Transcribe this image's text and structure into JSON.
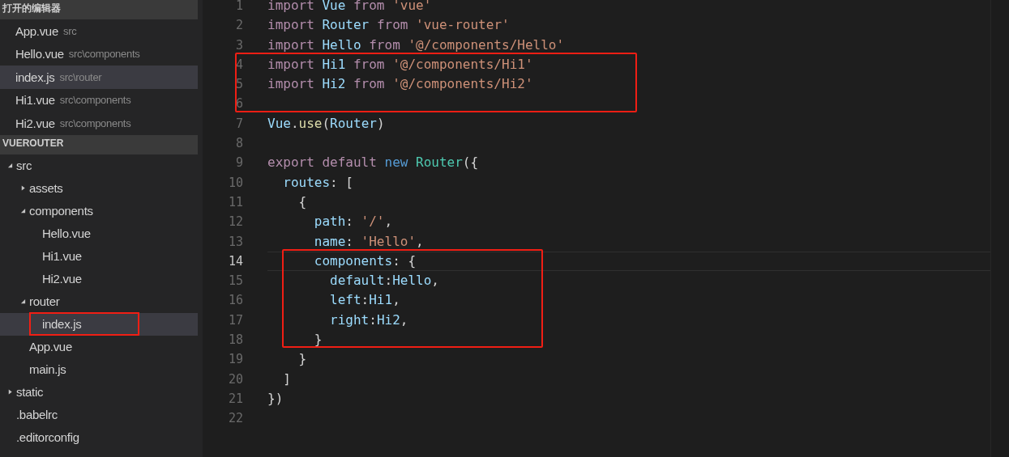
{
  "sidebar": {
    "open_editors": {
      "title": "打开的编辑器",
      "items": [
        {
          "name": "App.vue",
          "path": "src",
          "selected": false
        },
        {
          "name": "Hello.vue",
          "path": "src\\components",
          "selected": false
        },
        {
          "name": "index.js",
          "path": "src\\router",
          "selected": true
        },
        {
          "name": "Hi1.vue",
          "path": "src\\components",
          "selected": false
        },
        {
          "name": "Hi2.vue",
          "path": "src\\components",
          "selected": false
        }
      ]
    },
    "explorer": {
      "title": "VUEROUTER",
      "tree": [
        {
          "kind": "folder",
          "name": "src",
          "expanded": true,
          "selected": false,
          "boxed": false,
          "children": [
            {
              "kind": "folder",
              "name": "assets",
              "expanded": false,
              "selected": false,
              "boxed": false
            },
            {
              "kind": "folder",
              "name": "components",
              "expanded": true,
              "selected": false,
              "boxed": false,
              "children": [
                {
                  "kind": "file",
                  "name": "Hello.vue",
                  "selected": false,
                  "boxed": false
                },
                {
                  "kind": "file",
                  "name": "Hi1.vue",
                  "selected": false,
                  "boxed": false
                },
                {
                  "kind": "file",
                  "name": "Hi2.vue",
                  "selected": false,
                  "boxed": false
                }
              ]
            },
            {
              "kind": "folder",
              "name": "router",
              "expanded": true,
              "selected": false,
              "boxed": false,
              "children": [
                {
                  "kind": "file",
                  "name": "index.js",
                  "selected": true,
                  "boxed": true
                }
              ]
            },
            {
              "kind": "file",
              "name": "App.vue",
              "selected": false,
              "boxed": false
            },
            {
              "kind": "file",
              "name": "main.js",
              "selected": false,
              "boxed": false
            }
          ]
        },
        {
          "kind": "folder",
          "name": "static",
          "expanded": false,
          "selected": false,
          "boxed": false
        },
        {
          "kind": "file",
          "name": ".babelrc",
          "selected": false,
          "boxed": false
        },
        {
          "kind": "file",
          "name": ".editorconfig",
          "selected": false,
          "boxed": false
        }
      ]
    }
  },
  "editor": {
    "sections": [
      {
        "kind": "plain",
        "lines": [
          {
            "number": "1",
            "current": false,
            "tokens": [
              {
                "kind": "kw",
                "text": "import "
              },
              {
                "kind": "var",
                "text": "Vue "
              },
              {
                "kind": "kw",
                "text": "from "
              },
              {
                "kind": "str",
                "text": "'vue'"
              }
            ]
          },
          {
            "number": "2",
            "current": false,
            "tokens": [
              {
                "kind": "kw",
                "text": "import "
              },
              {
                "kind": "var",
                "text": "Router "
              },
              {
                "kind": "kw",
                "text": "from "
              },
              {
                "kind": "str",
                "text": "'vue-router'"
              }
            ]
          },
          {
            "number": "3",
            "current": false,
            "tokens": [
              {
                "kind": "kw",
                "text": "import "
              },
              {
                "kind": "var",
                "text": "Hello "
              },
              {
                "kind": "kw",
                "text": "from "
              },
              {
                "kind": "str",
                "text": "'@/components/Hello'"
              }
            ]
          }
        ]
      },
      {
        "kind": "boxed",
        "lines": [
          {
            "number": "4",
            "current": false,
            "tokens": [
              {
                "kind": "kw",
                "text": "import "
              },
              {
                "kind": "var",
                "text": "Hi1 "
              },
              {
                "kind": "kw",
                "text": "from "
              },
              {
                "kind": "str",
                "text": "'@/components/Hi1'"
              }
            ]
          },
          {
            "number": "5",
            "current": false,
            "tokens": [
              {
                "kind": "kw",
                "text": "import "
              },
              {
                "kind": "var",
                "text": "Hi2 "
              },
              {
                "kind": "kw",
                "text": "from "
              },
              {
                "kind": "str",
                "text": "'@/components/Hi2'"
              }
            ]
          },
          {
            "number": "6",
            "current": false
          }
        ]
      },
      {
        "kind": "plain",
        "lines": [
          {
            "number": "7",
            "current": false,
            "tokens": [
              {
                "kind": "var",
                "text": "Vue"
              },
              {
                "kind": "punc",
                "text": "."
              },
              {
                "kind": "fn",
                "text": "use"
              },
              {
                "kind": "punc",
                "text": "("
              },
              {
                "kind": "var",
                "text": "Router"
              },
              {
                "kind": "punc",
                "text": ")"
              }
            ]
          },
          {
            "number": "8",
            "current": false
          },
          {
            "number": "9",
            "current": false,
            "tokens": [
              {
                "kind": "kw",
                "text": "export "
              },
              {
                "kind": "kw",
                "text": "default "
              },
              {
                "kind": "op",
                "text": "new "
              },
              {
                "kind": "cls",
                "text": "Router"
              },
              {
                "kind": "punc",
                "text": "({"
              }
            ]
          },
          {
            "number": "10",
            "current": false,
            "tokens": [
              {
                "kind": "var",
                "text": "  routes"
              },
              {
                "kind": "punc",
                "text": ": ["
              }
            ]
          },
          {
            "number": "11",
            "current": false,
            "tokens": [
              {
                "kind": "punc",
                "text": "    {"
              }
            ]
          },
          {
            "number": "12",
            "current": false,
            "tokens": [
              {
                "kind": "var",
                "text": "      path"
              },
              {
                "kind": "punc",
                "text": ": "
              },
              {
                "kind": "str",
                "text": "'/'"
              },
              {
                "kind": "punc",
                "text": ","
              }
            ]
          },
          {
            "number": "13",
            "current": false,
            "tokens": [
              {
                "kind": "var",
                "text": "      name"
              },
              {
                "kind": "punc",
                "text": ": "
              },
              {
                "kind": "str",
                "text": "'Hello'"
              },
              {
                "kind": "punc",
                "text": ","
              }
            ]
          }
        ]
      },
      {
        "kind": "boxed",
        "lines": [
          {
            "number": "14",
            "current": true,
            "tokens": [
              {
                "kind": "var",
                "text": "      components"
              },
              {
                "kind": "punc",
                "text": ": {"
              }
            ]
          },
          {
            "number": "15",
            "current": false,
            "tokens": [
              {
                "kind": "var",
                "text": "        default"
              },
              {
                "kind": "punc",
                "text": ":"
              },
              {
                "kind": "var",
                "text": "Hello"
              },
              {
                "kind": "punc",
                "text": ","
              }
            ]
          },
          {
            "number": "16",
            "current": false,
            "tokens": [
              {
                "kind": "var",
                "text": "        left"
              },
              {
                "kind": "punc",
                "text": ":"
              },
              {
                "kind": "var",
                "text": "Hi1"
              },
              {
                "kind": "punc",
                "text": ","
              }
            ]
          },
          {
            "number": "17",
            "current": false,
            "tokens": [
              {
                "kind": "var",
                "text": "        right"
              },
              {
                "kind": "punc",
                "text": ":"
              },
              {
                "kind": "var",
                "text": "Hi2"
              },
              {
                "kind": "punc",
                "text": ","
              }
            ]
          },
          {
            "number": "18",
            "current": false,
            "tokens": [
              {
                "kind": "punc",
                "text": "      }"
              }
            ]
          }
        ]
      },
      {
        "kind": "plain",
        "lines": [
          {
            "number": "19",
            "current": false,
            "tokens": [
              {
                "kind": "punc",
                "text": "    }"
              }
            ]
          },
          {
            "number": "20",
            "current": false,
            "tokens": [
              {
                "kind": "punc",
                "text": "  ]"
              }
            ]
          },
          {
            "number": "21",
            "current": false,
            "tokens": [
              {
                "kind": "punc",
                "text": "})"
              }
            ]
          },
          {
            "number": "22",
            "current": false
          }
        ]
      }
    ]
  }
}
